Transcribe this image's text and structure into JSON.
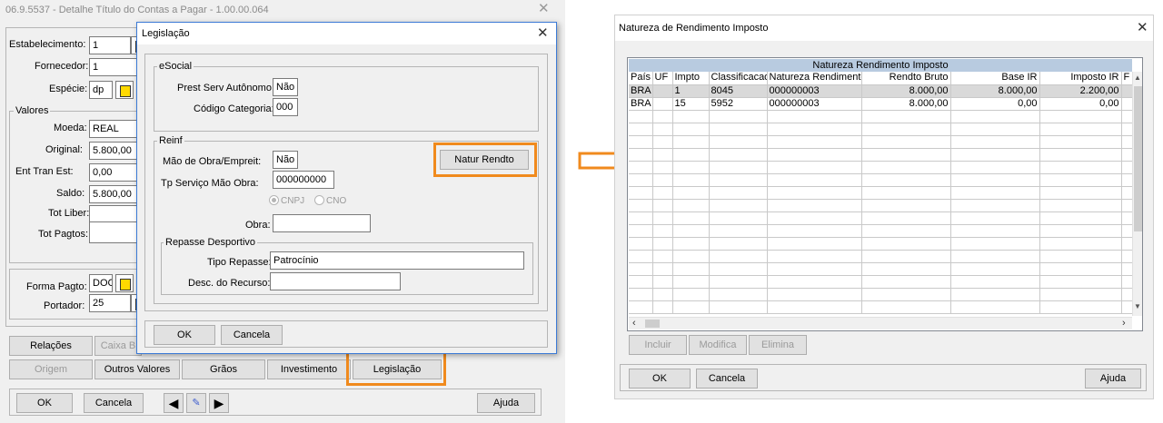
{
  "main_window": {
    "title": "06.9.5537 - Detalhe Título do Contas a Pagar - 1.00.00.064",
    "fields": {
      "estabelecimento_label": "Estabelecimento:",
      "estabelecimento": "1",
      "fornecedor_label": "Fornecedor:",
      "fornecedor": "1",
      "especie_label": "Espécie:",
      "especie": "dp"
    },
    "valores": {
      "legend": "Valores",
      "moeda_label": "Moeda:",
      "moeda": "REAL",
      "original_label": "Original:",
      "original": "5.800,00",
      "ent_tran_label": "Ent Tran Est:",
      "ent_tran": "0,00",
      "saldo_label": "Saldo:",
      "saldo": "5.800,00",
      "tot_liber_label": "Tot Liber:",
      "tot_liber": "",
      "tot_pagtos_label": "Tot Pagtos:",
      "tot_pagtos": ""
    },
    "forma_pagto_label": "Forma Pagto:",
    "forma_pagto": "DOC",
    "portador_label": "Portador:",
    "portador": "25",
    "tabs_row1": [
      "Relações",
      "Caixa B"
    ],
    "tabs_row2": [
      "Origem",
      "Outros Valores",
      "Grãos",
      "Investimento",
      "Legislação"
    ],
    "buttons": {
      "ok": "OK",
      "cancela": "Cancela",
      "ajuda": "Ajuda"
    }
  },
  "legislacao_dialog": {
    "title": "Legislação",
    "esocial": {
      "legend": "eSocial",
      "prest_serv_label": "Prest Serv Autônomo:",
      "prest_serv": "Não",
      "codigo_categoria_label": "Código Categoria:",
      "codigo_categoria": "000"
    },
    "reinf": {
      "legend": "Reinf",
      "mao_obra_label": "Mão de Obra/Empreit:",
      "mao_obra": "Não",
      "tp_servico_label": "Tp Serviço Mão Obra:",
      "tp_servico": "000000000",
      "radio_cnpj": "CNPJ",
      "radio_cno": "CNO",
      "obra_label": "Obra:",
      "obra": "",
      "natur_rendto_button": "Natur Rendto"
    },
    "repasse": {
      "legend": "Repasse Desportivo",
      "tipo_repasse_label": "Tipo Repasse:",
      "tipo_repasse": "Patrocínio",
      "desc_recurso_label": "Desc. do Recurso:",
      "desc_recurso": ""
    },
    "buttons": {
      "ok": "OK",
      "cancela": "Cancela"
    }
  },
  "natureza_window": {
    "title": "Natureza de Rendimento Imposto",
    "grid_title": "Natureza Rendimento Imposto",
    "columns": [
      "País",
      "UF",
      "Impto",
      "Classificacao",
      "Natureza Rendimento",
      "Rendto Bruto",
      "Base IR",
      "Imposto IR",
      "F"
    ],
    "rows": [
      [
        "BRA",
        "",
        "1",
        "8045",
        "000000003",
        "8.000,00",
        "8.000,00",
        "2.200,00",
        ""
      ],
      [
        "BRA",
        "",
        "15",
        "5952",
        "000000003",
        "8.000,00",
        "0,00",
        "0,00",
        ""
      ]
    ],
    "action_buttons": [
      "Incluir",
      "Modifica",
      "Elimina"
    ],
    "buttons": {
      "ok": "OK",
      "cancela": "Cancela",
      "ajuda": "Ajuda"
    }
  },
  "colors": {
    "highlight": "#f08a1d",
    "window_bg": "#f0f0f0",
    "grid_header": "#b8cbe0"
  }
}
